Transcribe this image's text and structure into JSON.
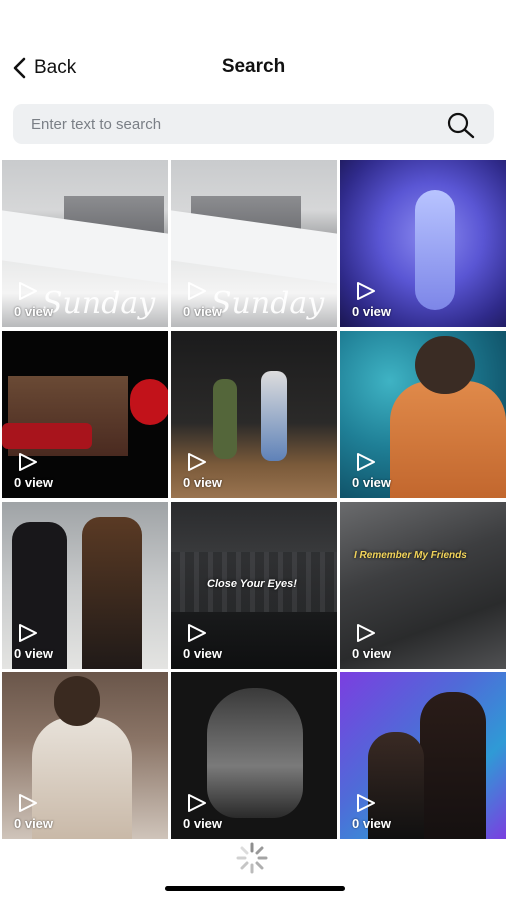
{
  "header": {
    "back_label": "Back",
    "title": "Search"
  },
  "search": {
    "placeholder": "Enter text to search",
    "value": ""
  },
  "videos": [
    {
      "views": "0 view",
      "overlay": "Sunday"
    },
    {
      "views": "0 view",
      "overlay": "Sunday"
    },
    {
      "views": "0 view",
      "overlay": ""
    },
    {
      "views": "0 view",
      "overlay": ""
    },
    {
      "views": "0 view",
      "overlay": ""
    },
    {
      "views": "0 view",
      "overlay": ""
    },
    {
      "views": "0 view",
      "overlay": ""
    },
    {
      "views": "0 view",
      "overlay": "Close Your Eyes!"
    },
    {
      "views": "0 view",
      "overlay": "I Remember My Friends"
    },
    {
      "views": "0 view",
      "overlay": ""
    },
    {
      "views": "0 view",
      "overlay": ""
    },
    {
      "views": "0 view",
      "overlay": ""
    }
  ],
  "icons": {
    "back": "chevron-left-icon",
    "search": "search-icon",
    "play": "play-icon",
    "loading": "loading-spinner-icon"
  }
}
